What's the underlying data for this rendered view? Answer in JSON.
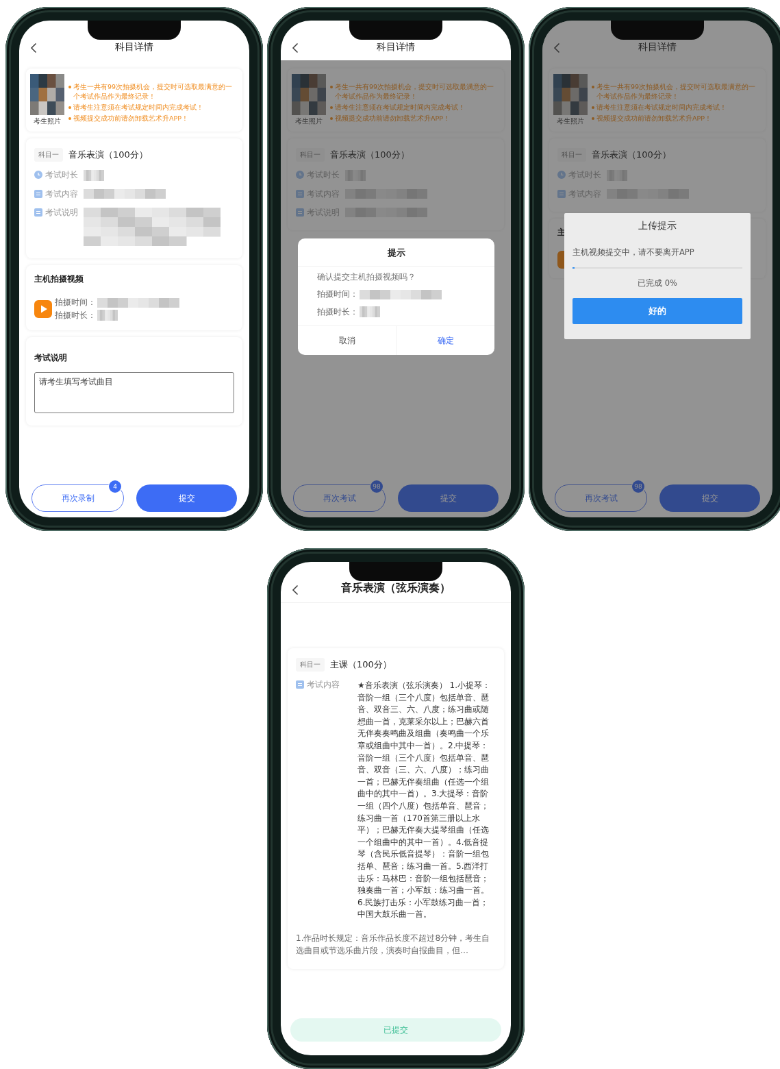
{
  "phones": [
    {
      "kind": "exam",
      "header": {
        "title": "科目详情"
      },
      "notice": {
        "photo_caption": "考生照片",
        "lines": [
          "考生一共有99次拍摄机会，提交时可选取最满意的一个考试作品作为最终记录！",
          "请考生注意须在考试规定时间内完成考试！",
          "视频提交成功前请勿卸载艺术升APP！"
        ]
      },
      "subject": {
        "tag": "科目一",
        "title": "音乐表演（100分）",
        "fields": [
          {
            "kind": "clock",
            "label": "考试时长",
            "redacted": true,
            "short": true
          },
          {
            "kind": "doc",
            "label": "考试内容",
            "redacted": true,
            "short": false
          },
          {
            "kind": "doc",
            "label": "考试说明",
            "redacted": true,
            "short": false,
            "multiline": true
          }
        ]
      },
      "video": {
        "title": "主机拍摄视频",
        "lines": [
          {
            "label": "拍摄时间：",
            "redacted": true,
            "short": false
          },
          {
            "label": "拍摄时长：",
            "redacted": true,
            "short": true
          }
        ]
      },
      "remark": {
        "title": "考试说明",
        "placeholder": "请考生填写考试曲目"
      },
      "footer": {
        "retry": {
          "label": "再次录制",
          "badge": "4"
        },
        "submit": {
          "label": "提交"
        }
      }
    },
    {
      "kind": "exam",
      "header": {
        "title": "科目详情"
      },
      "notice": {
        "photo_caption": "考生照片",
        "lines": [
          "考生一共有99次拍摄机会，提交时可选取最满意的一个考试作品作为最终记录！",
          "请考生注意须在考试规定时间内完成考试！",
          "视频提交成功前请勿卸载艺术升APP！"
        ]
      },
      "subject": {
        "tag": "科目一",
        "title": "音乐表演（100分）",
        "fields": [
          {
            "kind": "clock",
            "label": "考试时长",
            "redacted": true,
            "short": true
          },
          {
            "kind": "doc",
            "label": "考试内容",
            "redacted": true,
            "short": false
          },
          {
            "kind": "doc",
            "label": "考试说明",
            "redacted": true,
            "short": false
          }
        ]
      },
      "footer": {
        "retry": {
          "label": "再次考试",
          "badge": "98"
        },
        "submit": {
          "label": "提交"
        }
      },
      "dialog": {
        "kind": "confirm",
        "covers_header": false,
        "title": "提示",
        "message": "确认提交主机拍摄视频吗？",
        "lines": [
          {
            "label": "拍摄时间：",
            "redacted": true,
            "short": false
          },
          {
            "label": "拍摄时长：",
            "redacted": true,
            "short": true
          }
        ],
        "buttons": [
          {
            "kind": "cancel",
            "label": "取消"
          },
          {
            "kind": "ok",
            "label": "确定"
          }
        ]
      }
    },
    {
      "kind": "exam",
      "header": {
        "title": "科目详情"
      },
      "notice": {
        "photo_caption": "考生照片",
        "lines": [
          "考生一共有99次拍摄机会，提交时可选取最满意的一个考试作品作为最终记录！",
          "请考生注意须在考试规定时间内完成考试！",
          "视频提交成功前请勿卸载艺术升APP！"
        ]
      },
      "subject": {
        "tag": "科目一",
        "title": "音乐表演（100分）",
        "fields": [
          {
            "kind": "clock",
            "label": "考试时长",
            "redacted": true,
            "short": true
          },
          {
            "kind": "doc",
            "label": "考试内容",
            "redacted": true,
            "short": false
          }
        ]
      },
      "video": {
        "title": "主"
      },
      "footer": {
        "retry": {
          "label": "再次考试",
          "badge": "98"
        },
        "submit": {
          "label": "提交"
        }
      },
      "dialog": {
        "kind": "progress",
        "covers_header": true,
        "title": "上传提示",
        "message": "主机视频提交中，请不要离开APP",
        "level": 0.01,
        "status": "已完成 0%",
        "button": "好的"
      }
    },
    {
      "kind": "result",
      "header": {
        "title": "音乐表演（弦乐演奏）"
      },
      "subject": {
        "tag": "科目一",
        "title": "主课（100分）",
        "fields": [
          {
            "kind": "doc",
            "label": "考试内容",
            "value": "★音乐表演（弦乐演奏） 1.小提琴：音阶一组（三个八度）包括单音、琶音、双音三、六、八度；练习曲或随想曲一首，克莱采尔以上；巴赫六首无伴奏奏鸣曲及组曲（奏鸣曲一个乐章或组曲中其中一首）。2.中提琴：音阶一组（三个八度）包括单音、琶音、双音（三、六、八度）；练习曲一首；巴赫无伴奏组曲（任选一个组曲中的其中一首）。3.大提琴：音阶一组（四个八度）包括单音、琶音；练习曲一首（170首第三册以上水平）；巴赫无伴奏大提琴组曲（任选一个组曲中的其中一首）。4.低音提琴（含民乐低音提琴）：音阶一组包括单、琶音；练习曲一首。5.西洋打击乐：马林巴：音阶一组包括琶音；独奏曲一首；小军鼓：练习曲一首。6.民族打击乐：小军鼓练习曲一首；中国大鼓乐曲一首。"
          }
        ]
      },
      "note": "1.作品时长规定：音乐作品长度不超过8分钟，考生自选曲目或节选乐曲片段，演奏时自报曲目，但…",
      "footer": {
        "status": {
          "label": "已提交"
        }
      }
    }
  ]
}
